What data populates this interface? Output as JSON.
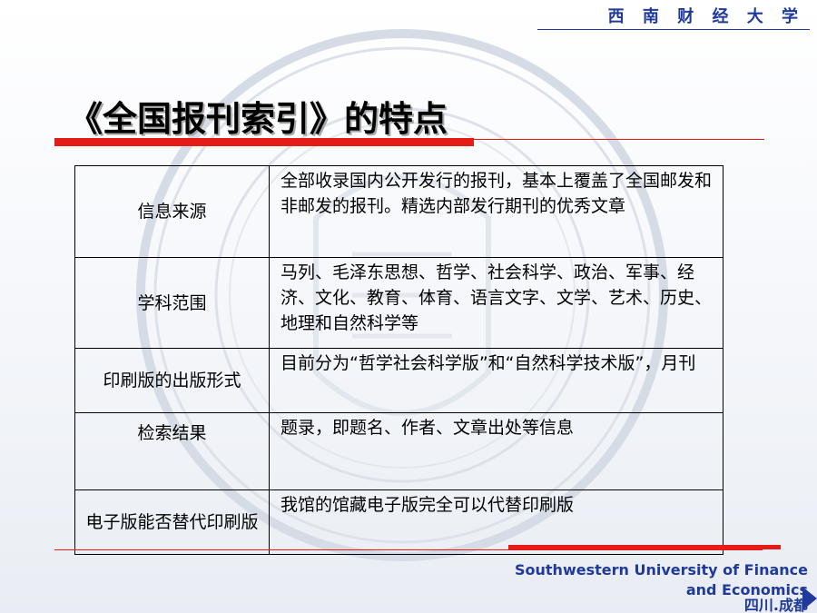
{
  "header": {
    "brand": "西 南 财 经 大 学",
    "title": "《全国报刊索引》的特点"
  },
  "table": {
    "rows": [
      {
        "label": "信息来源",
        "text": "全部收录国内公开发行的报刊，基本上覆盖了全国邮发和非邮发的报刊。精选内部发行期刊的优秀文章"
      },
      {
        "label": "学科范围",
        "text": "马列、毛泽东思想、哲学、社会科学、政治、军事、经济、文化、教育、体育、语言文字、文学、艺术、历史、地理和自然科学等"
      },
      {
        "label": "印刷版的出版形式",
        "text": "目前分为“哲学社会科学版”和“自然科学技术版”，月刊"
      },
      {
        "label": "检索结果",
        "text": "题录，即题名、作者、文章出处等信息"
      },
      {
        "label": "电子版能否替代印刷版",
        "text": "我馆的馆藏电子版完全可以代替印刷版"
      }
    ]
  },
  "footer": {
    "english": "Southwestern University of Finance and Economics",
    "chinese": "四川.成都"
  },
  "colors": {
    "brand_blue": "#1f3a9a",
    "accent_red": "#e41b17"
  },
  "icons": {
    "watermark": "university-seal-icon",
    "corner": "triangle-right-icon"
  }
}
